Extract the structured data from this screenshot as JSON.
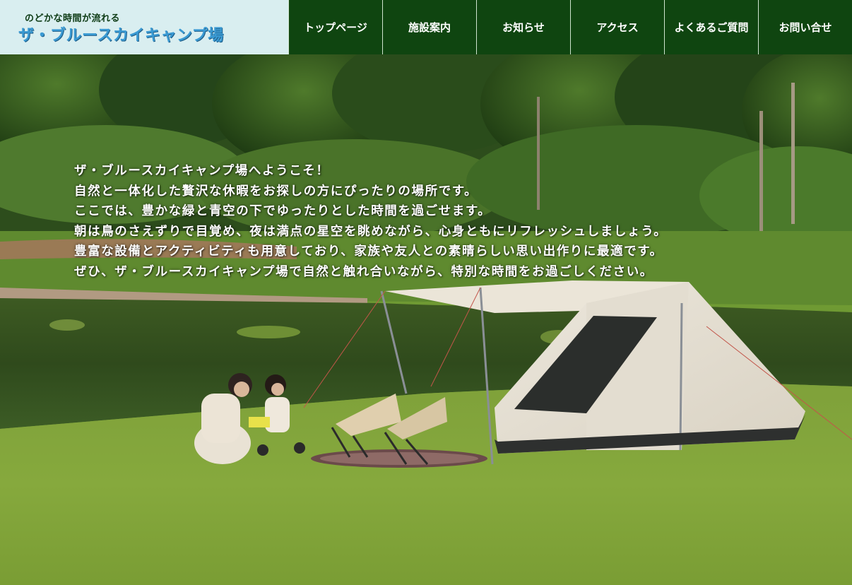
{
  "site": {
    "tagline": "のどかな時間が流れる",
    "name": "ザ・ブルースカイキャンプ場"
  },
  "nav": {
    "items": [
      {
        "label": "トップページ"
      },
      {
        "label": "施設案内"
      },
      {
        "label": "お知らせ"
      },
      {
        "label": "アクセス"
      },
      {
        "label": "よくあるご質問"
      },
      {
        "label": "お問い合せ"
      }
    ]
  },
  "hero": {
    "lines": [
      "ザ・ブルースカイキャンプ場へようこそ！",
      "自然と一体化した贅沢な休暇をお探しの方にぴったりの場所です。",
      "ここでは、豊かな緑と青空の下でゆったりとした時間を過ごせます。",
      "朝は鳥のさえずりで目覚め、夜は満点の星空を眺めながら、心身ともにリフレッシュしましょう。",
      "豊富な設備とアクティビティも用意しており、家族や友人との素晴らしい思い出作りに最適です。",
      "ぜひ、ザ・ブルースカイキャンプ場で自然と触れ合いながら、特別な時間をお過ごしください。"
    ]
  },
  "colors": {
    "nav_bg": "#0f4510",
    "logo_bg": "#d9eef0",
    "logo_name": "#3a9ad3",
    "logo_tagline": "#0d3b15"
  }
}
